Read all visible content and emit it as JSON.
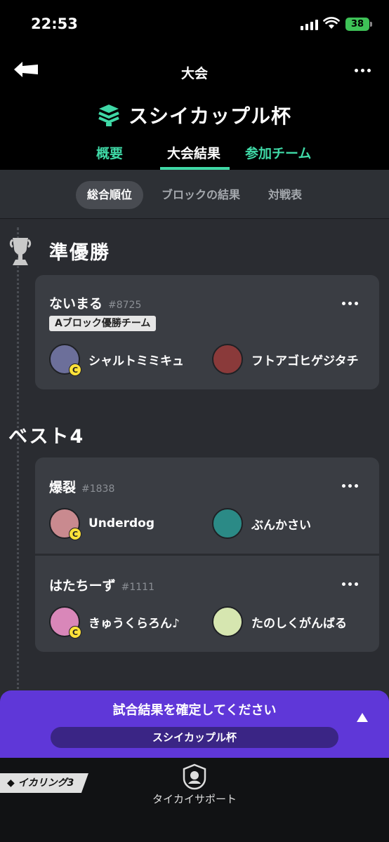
{
  "status": {
    "time": "22:53",
    "battery": "38"
  },
  "nav": {
    "title": "大会",
    "tournament_name": "スシイカップル杯",
    "tabs": [
      {
        "label": "概要",
        "active": false
      },
      {
        "label": "大会結果",
        "active": true
      },
      {
        "label": "参加チーム",
        "active": false
      }
    ]
  },
  "subtabs": [
    {
      "label": "総合順位",
      "active": true
    },
    {
      "label": "ブロックの結果",
      "active": false
    },
    {
      "label": "対戦表",
      "active": false
    }
  ],
  "sections": [
    {
      "title": "準優勝",
      "teams": [
        {
          "name": "ないまる",
          "tag": "#8725",
          "badge": "Aブロック優勝チーム",
          "players": [
            {
              "name": "シャルトミミキュ",
              "captain": true,
              "avatar_color": "#6c6f9a"
            },
            {
              "name": "フトアゴヒゲジタチ",
              "captain": false,
              "avatar_color": "#8a3a3a"
            }
          ]
        }
      ]
    },
    {
      "title": "ベスト4",
      "teams": [
        {
          "name": "爆裂",
          "tag": "#1838",
          "players": [
            {
              "name": "Underdog",
              "captain": true,
              "avatar_color": "#c98a8f"
            },
            {
              "name": "ぶんかさい",
              "captain": false,
              "avatar_color": "#2b8a86"
            }
          ]
        },
        {
          "name": "はたちーず",
          "tag": "#1111",
          "players": [
            {
              "name": "きゅうくらろん♪",
              "captain": true,
              "avatar_color": "#d987b9"
            },
            {
              "name": "たのしくがんばる",
              "captain": false,
              "avatar_color": "#d6e6b0"
            }
          ]
        }
      ]
    }
  ],
  "captain_badge": "C",
  "banner": {
    "message": "試合結果を確定してください",
    "tournament": "スシイカップル杯"
  },
  "bottom": {
    "app_label": "イカリング3",
    "support_label": "タイカイサポート"
  },
  "colors": {
    "accent": "#3fd8a6",
    "banner": "#5f37d8",
    "captain": "#ffe23a"
  }
}
